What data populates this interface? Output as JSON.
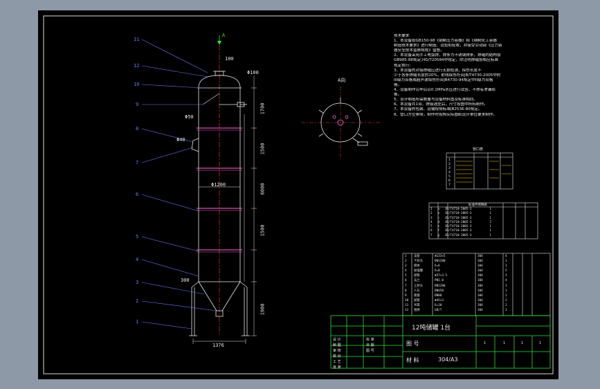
{
  "drawing": {
    "view_marker": "A",
    "view_label": "A向",
    "part_numbers": [
      "11",
      "12",
      "10",
      "9",
      "8",
      "7",
      "6",
      "5",
      "4",
      "3",
      "2",
      "1"
    ],
    "dimensions": {
      "top_nozzle": "100",
      "diameter": "Φ1200",
      "width": "1376",
      "h1": "1700",
      "h2": "1500",
      "h3": "6000",
      "h4": "1500",
      "h5": "1900",
      "side_a": "Φ50",
      "side_b": "Φ40",
      "side_c": "Φ100",
      "bottom_h": "300"
    }
  },
  "notes": {
    "title": "技术要求",
    "lines": [
      "1、本设备按GB150-98《钢制压力容器》和《钢制化工容器",
      "   制造技术要求》进行制造、试验和验收，并接受劳动部《压力容",
      "   器安全技术监察规程》监督。",
      "2、本设备采用手工电弧焊，焊条为不锈钢焊条，焊缝的结构按",
      "   GB985-88规定;HG/T20584中规定，除注明焊缝按相应标准",
      "   规定执行;",
      "3、本设备的对接焊缝应进行无损检测，探伤长度不",
      "   少于各条焊缝长度的20%，射线探伤符合JB/T4730-2005中的",
      "   III级为合格或超声波探伤符合JB4730-94规定中II级为合格",
      "   格。",
      "4、设备制作完毕后以0.1MPa水压进行试验，不得有渗漏现",
      "   象。",
      "5、设计制造所需数量与设备材料图及标准相同。",
      "6、本设备共1台，焊接选型后，尺寸按图中所标制作。",
      "7、本设备的包装、运输按照标准JB2536-80规定。",
      "8、管口方位参照，制作时按照实际图纸设计单位要求制作。"
    ]
  },
  "nozzle_table": {
    "title": "管口表",
    "rows": [
      "1",
      "2",
      "3",
      "4",
      "5",
      "6",
      "7"
    ]
  },
  "parts_table": {
    "header": "标准件明细表",
    "rows": [
      [
        "1",
        "a",
        "JB/T4710-2005-3",
        "1"
      ],
      [
        "2",
        "b",
        "JB/T4710-2005-3",
        "1"
      ],
      [
        "3",
        "c",
        "JB/T4710-2005-3",
        "1"
      ],
      [
        "4",
        "d",
        "JB/T4710-2005-3",
        "2"
      ],
      [
        "5",
        "e",
        "JB/T4710-2005-3",
        "1"
      ],
      [
        "6",
        "f",
        "JB/T4710-2005-3",
        "1"
      ],
      [
        "7",
        "g",
        "JB/T4710-2005-3",
        "1"
      ]
    ]
  },
  "bom": {
    "rows": [
      [
        "1",
        "支座",
        "Φ133×5",
        "304",
        "4"
      ],
      [
        "2",
        "下封头",
        "DN1200",
        "304",
        "1"
      ],
      [
        "3",
        "筒体",
        "δ=6",
        "304",
        "1"
      ],
      [
        "4",
        "加强圈",
        "δ=8",
        "304",
        "5"
      ],
      [
        "5",
        "接管",
        "Φ57×3.5",
        "304",
        "3"
      ],
      [
        "6",
        "法兰",
        "PN1.0",
        "304",
        "4"
      ],
      [
        "7",
        "上封头",
        "DN1200",
        "304",
        "1"
      ],
      [
        "8",
        "人孔",
        "DN450",
        "304",
        "1"
      ],
      [
        "9",
        "视镜",
        "DN80",
        "304",
        "1"
      ],
      [
        "10",
        "接管",
        "Φ45×3",
        "304",
        "2"
      ],
      [
        "11",
        "吊耳",
        "δ=10",
        "304",
        "2"
      ],
      [
        "12",
        "铭牌",
        "GB/T",
        "304",
        "1"
      ]
    ]
  },
  "title_block": {
    "title": "12吨储罐 1台",
    "material_label": "材 料",
    "material_value": "304/A3",
    "drawing_no_label": "图 号",
    "cells": [
      "设 计",
      "制 图",
      "审 核",
      "校 对",
      "工 艺",
      "批 准",
      "标 准",
      "日 期",
      "图 号"
    ],
    "scale_cells": [
      "1",
      "1",
      "1",
      "1"
    ]
  }
}
